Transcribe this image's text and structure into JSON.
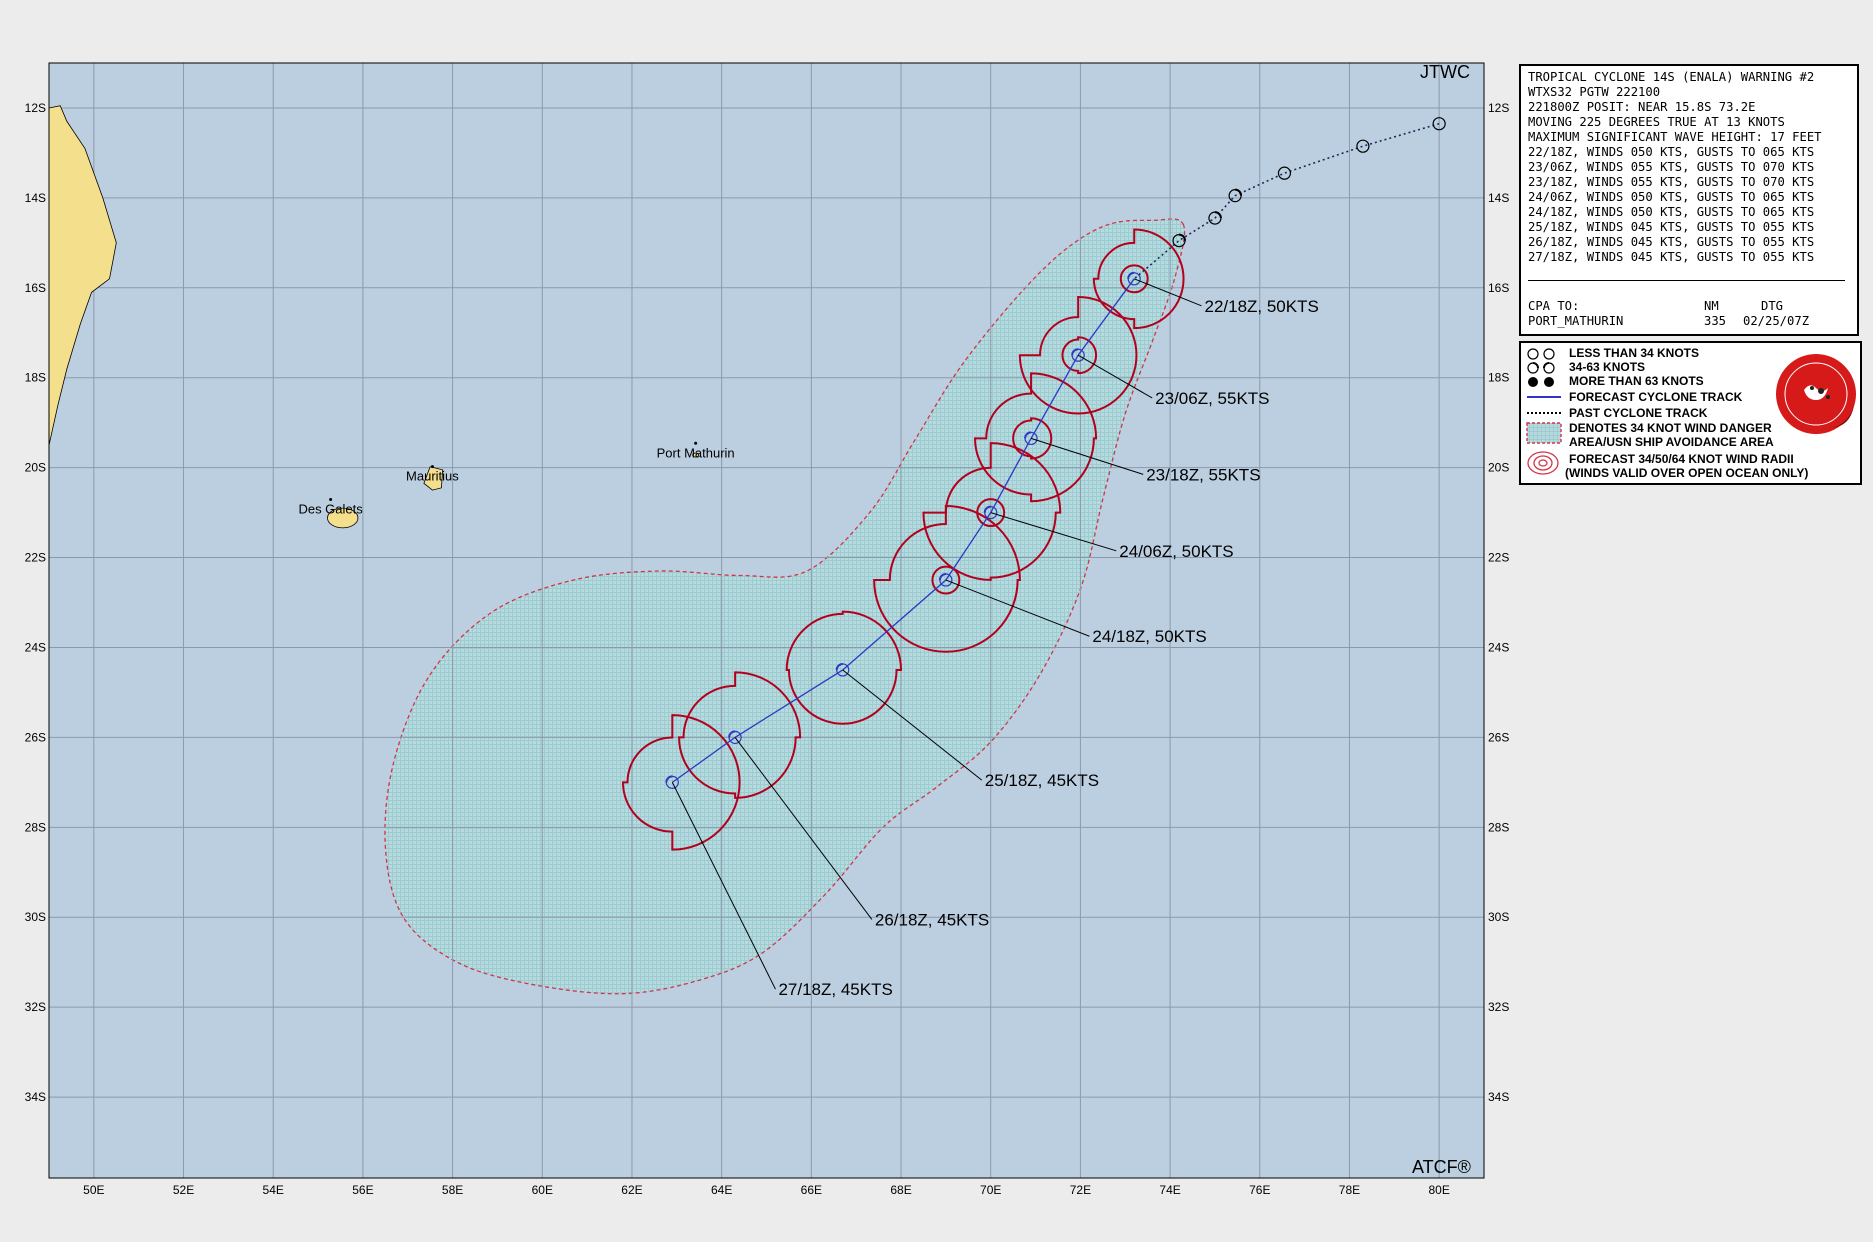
{
  "agency": "JTWC",
  "software": "ATCF®",
  "map": {
    "lon_range": [
      49,
      81
    ],
    "lat_range": [
      -11,
      -35.8
    ],
    "lon_ticks": [
      "50E",
      "52E",
      "54E",
      "56E",
      "58E",
      "60E",
      "62E",
      "64E",
      "66E",
      "68E",
      "70E",
      "72E",
      "74E",
      "76E",
      "78E",
      "80E"
    ],
    "lat_ticks": [
      "12S",
      "14S",
      "16S",
      "18S",
      "20S",
      "22S",
      "24S",
      "26S",
      "28S",
      "30S",
      "32S",
      "34S"
    ],
    "colors": {
      "ocean": "#bccfe0",
      "land": "#f3df8c",
      "danger_area": "#b7dbdf",
      "danger_edge": "#d2344a",
      "wind_radii": "#b3001c",
      "track": "#2f36c4",
      "grid": "#8b9aab"
    }
  },
  "places": [
    {
      "name": "Port Mathurin",
      "lon": 63.42,
      "lat": -19.68
    },
    {
      "name": "Mauritius",
      "lon": 57.55,
      "lat": -20.2
    },
    {
      "name": "Des Galets",
      "lon": 55.28,
      "lat": -20.93
    }
  ],
  "past_track": [
    {
      "lon": 80.0,
      "lat": -12.35
    },
    {
      "lon": 78.3,
      "lat": -12.85
    },
    {
      "lon": 76.55,
      "lat": -13.45
    },
    {
      "lon": 75.45,
      "lat": -13.95
    },
    {
      "lon": 75.0,
      "lat": -14.45
    },
    {
      "lon": 74.2,
      "lat": -14.95
    }
  ],
  "forecast_points": [
    {
      "label": "22/18Z,  50KTS",
      "lon": 73.2,
      "lat": -15.8,
      "label_lon": 74.7,
      "label_lat": -16.4,
      "r34": [
        1.1,
        1.1,
        0.9,
        0.8
      ],
      "r50": [
        0.3,
        0.3,
        0.3,
        0.3
      ]
    },
    {
      "label": "23/06Z,  55KTS",
      "lon": 71.95,
      "lat": -17.5,
      "label_lon": 73.6,
      "label_lat": -18.45,
      "r34": [
        1.3,
        1.3,
        1.3,
        0.85
      ],
      "r50": [
        0.4,
        0.4,
        0.35,
        0.35
      ]
    },
    {
      "label": "23/18Z,  55KTS",
      "lon": 70.9,
      "lat": -19.35,
      "label_lon": 73.4,
      "label_lat": -20.15,
      "r34": [
        1.45,
        1.4,
        1.25,
        1.0
      ],
      "r50": [
        0.45,
        0.45,
        0.4,
        0.4
      ]
    },
    {
      "label": "24/06Z,  50KTS",
      "lon": 70.0,
      "lat": -21.0,
      "label_lon": 72.8,
      "label_lat": -21.85,
      "r34": [
        1.55,
        1.45,
        1.5,
        1.0
      ],
      "r50": [
        0.3,
        0.3,
        0.3,
        0.3
      ]
    },
    {
      "label": "24/18Z,  50KTS",
      "lon": 69.0,
      "lat": -22.5,
      "label_lon": 72.2,
      "label_lat": -23.75,
      "r34": [
        1.65,
        1.6,
        1.6,
        1.25
      ],
      "r50": [
        0.3,
        0.3,
        0.3,
        0.3
      ]
    },
    {
      "label": "25/18Z,  45KTS",
      "lon": 66.7,
      "lat": -24.5,
      "label_lon": 69.8,
      "label_lat": -26.95
    },
    {
      "label": "26/18Z,  45KTS",
      "lon": 64.3,
      "lat": -26.0,
      "label_lon": 67.35,
      "label_lat": -30.05
    },
    {
      "label": "27/18Z,  45KTS",
      "lon": 62.9,
      "lat": -27.0,
      "label_lon": 65.2,
      "label_lat": -31.6
    }
  ],
  "warning": {
    "lines": [
      "TROPICAL CYCLONE 14S (ENALA) WARNING #2",
      "WTXS32 PGTW 222100",
      "221800Z POSIT: NEAR 15.8S 73.2E",
      "MOVING 225 DEGREES TRUE AT 13 KNOTS",
      "MAXIMUM SIGNIFICANT WAVE HEIGHT: 17 FEET",
      "22/18Z, WINDS 050 KTS, GUSTS TO 065 KTS",
      "23/06Z, WINDS 055 KTS, GUSTS TO 070 KTS",
      "23/18Z, WINDS 055 KTS, GUSTS TO 070 KTS",
      "24/06Z, WINDS 050 KTS, GUSTS TO 065 KTS",
      "24/18Z, WINDS 050 KTS, GUSTS TO 065 KTS",
      "25/18Z, WINDS 045 KTS, GUSTS TO 055 KTS",
      "26/18Z, WINDS 045 KTS, GUSTS TO 055 KTS",
      "27/18Z, WINDS 045 KTS, GUSTS TO 055 KTS"
    ],
    "cpa_header": "CPA TO:",
    "nm_header": "NM",
    "dtg_header": "DTG",
    "cpa_place": "PORT_MATHURIN",
    "cpa_nm": "335",
    "cpa_dtg": "02/25/07Z"
  },
  "legend": {
    "items": [
      "LESS THAN 34 KNOTS",
      "34-63 KNOTS",
      "MORE THAN 63 KNOTS",
      "FORECAST CYCLONE TRACK",
      "PAST CYCLONE TRACK",
      "DENOTES 34 KNOT WIND DANGER",
      "AREA/USN SHIP AVOIDANCE AREA",
      "FORECAST 34/50/64 KNOT WIND RADII",
      "(WINDS VALID OVER OPEN OCEAN ONLY)"
    ],
    "seal_icon": "jtwc-seal-icon"
  }
}
